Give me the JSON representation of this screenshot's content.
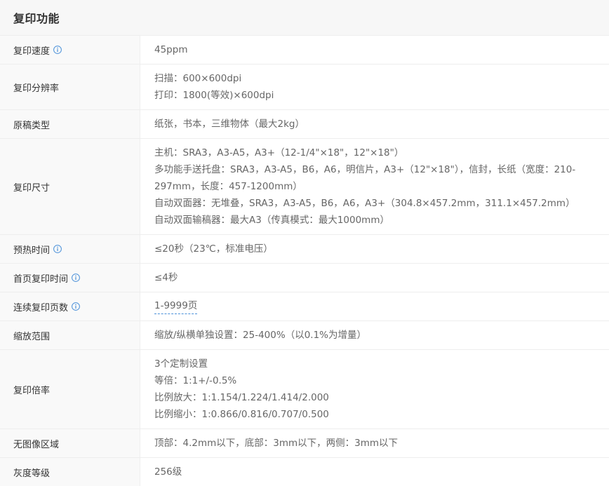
{
  "header": {
    "title": "复印功能"
  },
  "colors": {
    "info_icon": "#4a90d9",
    "header_bg": "#f7f7f7",
    "label_bg": "#f9f9f9",
    "border": "#eeeeee"
  },
  "rows": [
    {
      "label": "复印速度",
      "has_info_icon": true,
      "values": [
        "45ppm"
      ]
    },
    {
      "label": "复印分辨率",
      "has_info_icon": false,
      "values": [
        "扫描：600×600dpi",
        "打印：1800(等效)×600dpi"
      ]
    },
    {
      "label": "原稿类型",
      "has_info_icon": false,
      "values": [
        "纸张，书本，三维物体（最大2kg）"
      ]
    },
    {
      "label": "复印尺寸",
      "has_info_icon": false,
      "values": [
        "主机：SRA3，A3-A5，A3+（12-1/4\"×18\"，12\"×18\"）",
        "多功能手送托盘：SRA3，A3-A5，B6，A6，明信片，A3+（12\"×18\"），信封，长纸（宽度：210-297mm，长度：457-1200mm）",
        "自动双面器：无堆叠，SRA3，A3-A5，B6，A6，A3+（304.8×457.2mm，311.1×457.2mm）",
        "自动双面输稿器：最大A3（传真模式：最大1000mm）"
      ]
    },
    {
      "label": "预热时间",
      "has_info_icon": true,
      "values": [
        "≤20秒（23℃，标准电压）"
      ]
    },
    {
      "label": "首页复印时间",
      "has_info_icon": true,
      "values": [
        "≤4秒"
      ]
    },
    {
      "label": "连续复印页数",
      "has_info_icon": true,
      "values": [
        "1-9999页"
      ]
    },
    {
      "label": "缩放范围",
      "has_info_icon": false,
      "values": [
        "缩放/纵横单独设置：25-400%（以0.1%为增量）"
      ]
    },
    {
      "label": "复印倍率",
      "has_info_icon": false,
      "values": [
        "3个定制设置",
        "等倍：1:1+/-0.5%",
        "比例放大：1:1.154/1.224/1.414/2.000",
        "比例缩小：1:0.866/0.816/0.707/0.500"
      ]
    },
    {
      "label": "无图像区域",
      "has_info_icon": false,
      "values": [
        "顶部：4.2mm以下，底部：3mm以下，两侧：3mm以下"
      ]
    },
    {
      "label": "灰度等级",
      "has_info_icon": false,
      "values": [
        "256级"
      ]
    }
  ]
}
